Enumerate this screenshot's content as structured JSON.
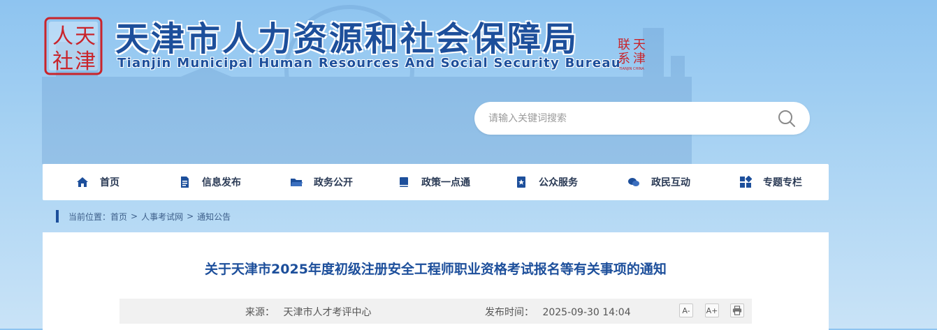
{
  "header": {
    "seal_chars": [
      "人",
      "天",
      "社",
      "津"
    ],
    "title_cn": "天津市人力资源和社会保障局",
    "title_en": "Tianjin Municipal Human Resources And Social Security Bureau",
    "small_seal_chars": [
      "联",
      "天",
      "系",
      "津"
    ],
    "small_seal_caption": "TIANJIN CHINA"
  },
  "search": {
    "placeholder": "请输入关键词搜索",
    "icon": "search-icon"
  },
  "nav": {
    "items": [
      {
        "label": "首页",
        "icon": "home-icon"
      },
      {
        "label": "信息发布",
        "icon": "document-icon"
      },
      {
        "label": "政务公开",
        "icon": "folder-icon"
      },
      {
        "label": "政策一点通",
        "icon": "book-icon"
      },
      {
        "label": "公众服务",
        "icon": "bookmark-star-icon"
      },
      {
        "label": "政民互动",
        "icon": "chat-icon"
      },
      {
        "label": "专题专栏",
        "icon": "grid-icon"
      }
    ]
  },
  "breadcrumb": {
    "prefix": "当前位置：",
    "items": [
      "首页",
      "人事考试网",
      "通知公告"
    ],
    "separator": ">"
  },
  "article": {
    "title": "关于天津市2025年度初级注册安全工程师职业资格考试报名等有关事项的通知",
    "source_label": "来源：",
    "source": "天津市人才考评中心",
    "time_label": "发布时间：",
    "time": "2025-09-30 14:04",
    "font_smaller": "A-",
    "font_larger": "A+",
    "print_icon": "print-icon"
  },
  "colors": {
    "brand_blue": "#1d4f9b",
    "seal_red": "#c9242b"
  }
}
